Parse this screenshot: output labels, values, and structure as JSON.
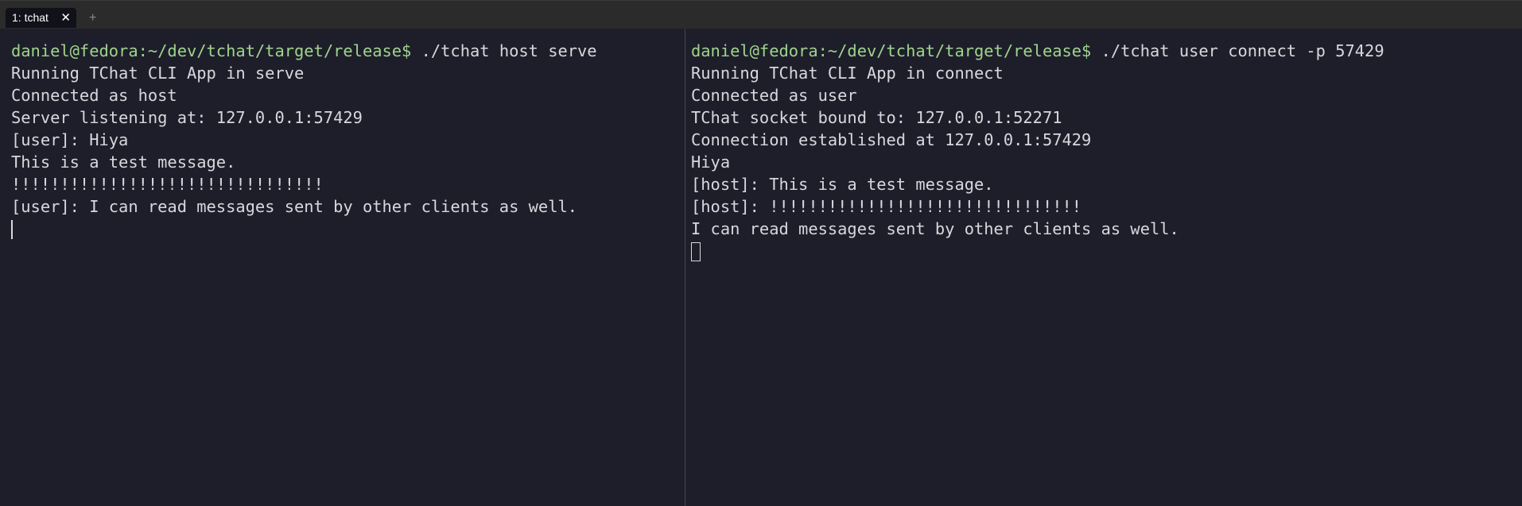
{
  "tabbar": {
    "tab_label": "1: tchat",
    "close_glyph": "✕",
    "new_tab_glyph": "+"
  },
  "left_pane": {
    "prompt": "daniel@fedora:~/dev/tchat/target/release$",
    "command": " ./tchat host serve",
    "output": [
      "Running TChat CLI App in serve",
      "Connected as host",
      "Server listening at: 127.0.0.1:57429",
      "[user]: Hiya",
      "This is a test message.",
      "!!!!!!!!!!!!!!!!!!!!!!!!!!!!!!!!",
      "[user]: I can read messages sent by other clients as well."
    ]
  },
  "right_pane": {
    "prompt": "daniel@fedora:~/dev/tchat/target/release$",
    "command": " ./tchat user connect -p 57429",
    "output": [
      "Running TChat CLI App in connect",
      "Connected as user",
      "TChat socket bound to: 127.0.0.1:52271",
      "Connection established at 127.0.0.1:57429",
      "Hiya",
      "[host]: This is a test message.",
      "[host]: !!!!!!!!!!!!!!!!!!!!!!!!!!!!!!!!",
      "I can read messages sent by other clients as well."
    ]
  },
  "colors": {
    "background": "#1e1e2b",
    "prompt": "#9fd48c",
    "text": "#d7d7dc"
  }
}
